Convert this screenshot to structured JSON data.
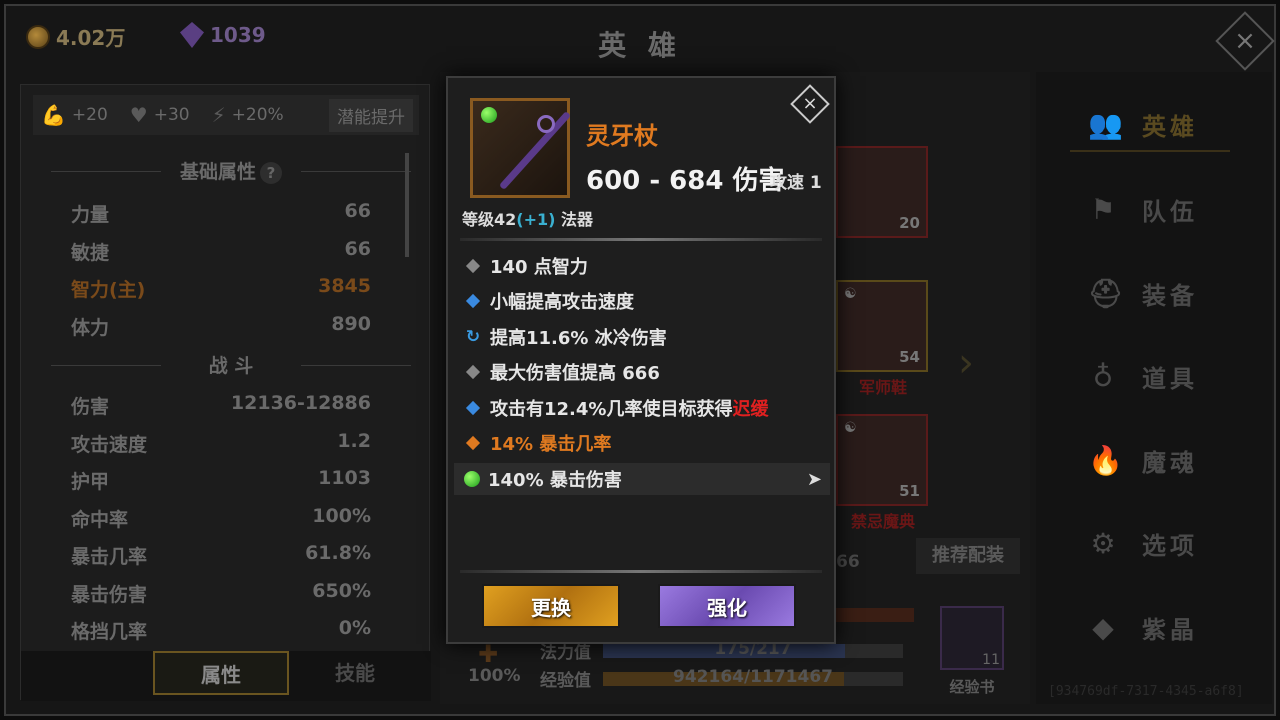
{
  "header": {
    "gold": "4.02万",
    "gems": "1039",
    "title": "英 雄"
  },
  "bonuses": {
    "strength": "+20",
    "health": "+30",
    "energy": "+20%",
    "potential_button": "潜能提升"
  },
  "basic_title": "基础属性",
  "basic_help": "?",
  "basic_stats": [
    {
      "label": "力量",
      "value": "66"
    },
    {
      "label": "敏捷",
      "value": "66"
    },
    {
      "label": "智力(主)",
      "value": "3845"
    },
    {
      "label": "体力",
      "value": "890"
    }
  ],
  "combat_title": "战 斗",
  "combat_stats": [
    {
      "label": "伤害",
      "value": "12136-12886"
    },
    {
      "label": "攻击速度",
      "value": "1.2"
    },
    {
      "label": "护甲",
      "value": "1103"
    },
    {
      "label": "命中率",
      "value": "100%"
    },
    {
      "label": "暴击几率",
      "value": "61.8%"
    },
    {
      "label": "暴击伤害",
      "value": "650%"
    },
    {
      "label": "格挡几率",
      "value": "0%"
    }
  ],
  "tabs": {
    "attributes": "属性",
    "skills": "技能"
  },
  "hero_area": {
    "slot1_num": "20",
    "slot2_num": "54",
    "slot2_name": "军师鞋",
    "slot3_num": "51",
    "slot3_name": "禁忌魔典",
    "partial_num": "66",
    "recommend": "推荐配装",
    "mana_label": "法力值",
    "mana_value": "175/217",
    "mana_fraction": 0.806,
    "exp_label": "经验值",
    "exp_value": "942164/1171467",
    "exp_fraction": 0.804,
    "percent": "100%",
    "expbook_count": "11",
    "expbook_label": "经验书"
  },
  "nav": [
    {
      "label": "英雄",
      "icon": "users-icon"
    },
    {
      "label": "队伍",
      "icon": "flag-icon"
    },
    {
      "label": "装备",
      "icon": "helmet-icon"
    },
    {
      "label": "道具",
      "icon": "bag-icon"
    },
    {
      "label": "魔魂",
      "icon": "flame-icon"
    },
    {
      "label": "选项",
      "icon": "gear-icon"
    },
    {
      "label": "紫晶",
      "icon": "gem-icon"
    }
  ],
  "watermark": "[934769df-7317-4345-a6f8]",
  "item": {
    "name": "灵牙杖",
    "damage": "600 - 684 伤害",
    "attack_speed": "攻速 1",
    "level_prefix": "等级42",
    "level_bonus": "(+1)",
    "type": "法器",
    "affixes": [
      {
        "text": "140 点智力"
      },
      {
        "text": "小幅提高攻击速度"
      },
      {
        "text": "提高11.6% 冰冷伤害"
      },
      {
        "text": "最大伤害值提高 666"
      },
      {
        "text": "攻击有12.4%几率使目标获得",
        "highlight": "迟缓"
      },
      {
        "text": "14% 暴击几率"
      },
      {
        "text": "140% 暴击伤害"
      }
    ],
    "swap_button": "更换",
    "enhance_button": "强化"
  },
  "colors": {
    "item_name": "#e07a20",
    "orange_affix": "#e07a20",
    "slow_red": "#e02020",
    "level_bonus": "#3ab0d0",
    "swap_btn": "#e0a020",
    "enhance_btn": "#8a6ad0"
  }
}
